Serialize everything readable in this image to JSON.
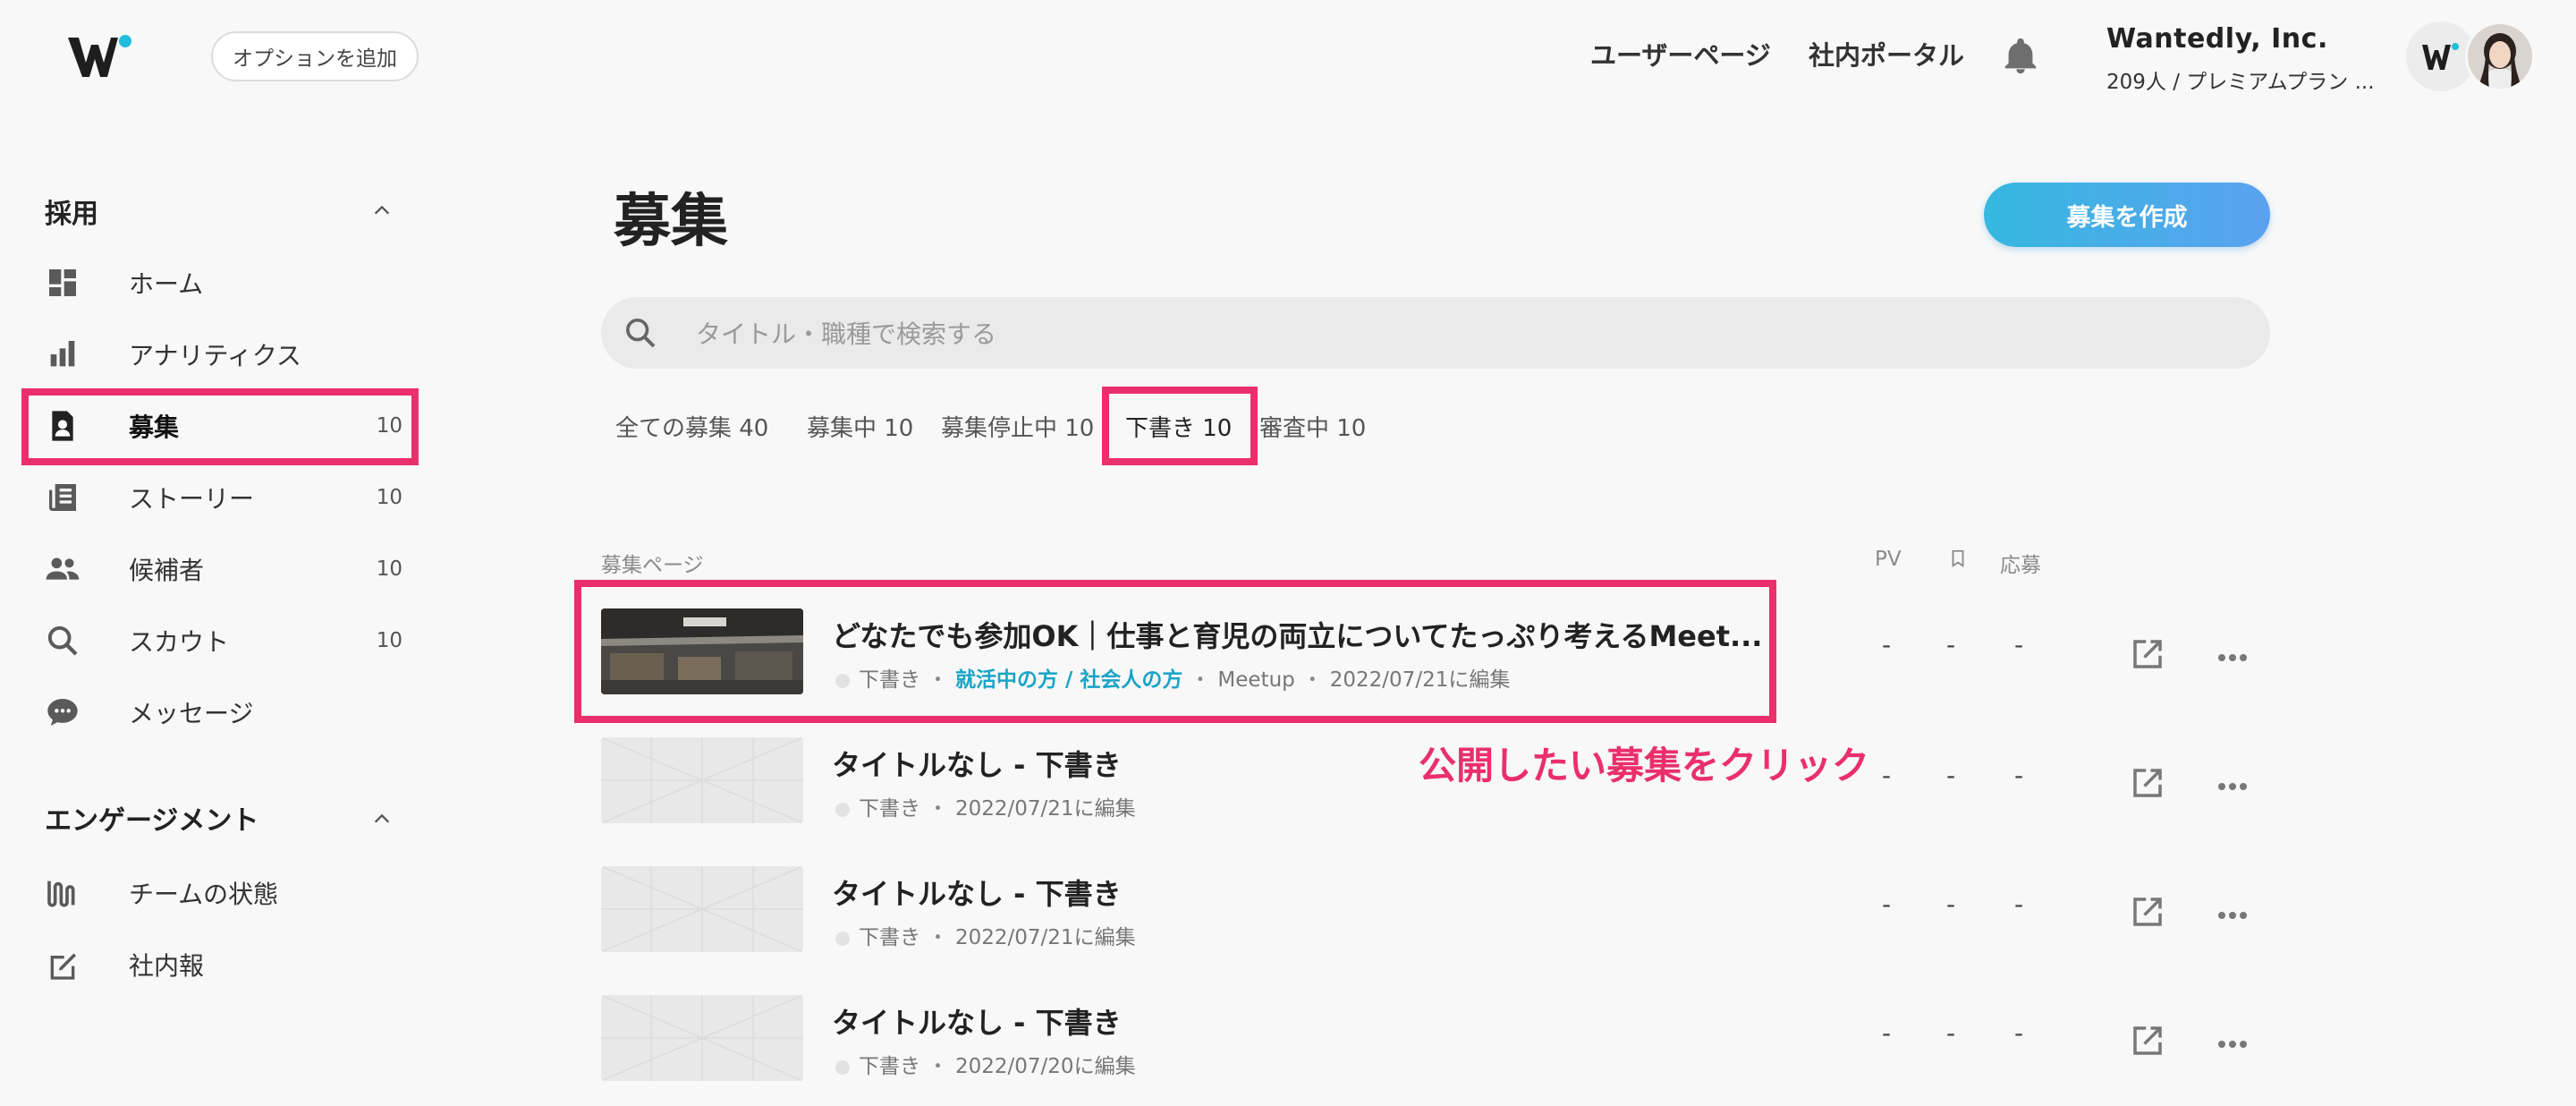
{
  "header": {
    "option_button": "オプションを追加",
    "nav_user_page": "ユーザーページ",
    "nav_portal": "社内ポータル",
    "company_name": "Wantedly, Inc.",
    "company_plan": "209人 / プレミアムプラン ..."
  },
  "sidebar": {
    "section_recruit": "採用",
    "items": [
      {
        "label": "ホーム",
        "count": ""
      },
      {
        "label": "アナリティクス",
        "count": ""
      },
      {
        "label": "募集",
        "count": "10"
      },
      {
        "label": "ストーリー",
        "count": "10"
      },
      {
        "label": "候補者",
        "count": "10"
      },
      {
        "label": "スカウト",
        "count": "10"
      },
      {
        "label": "メッセージ",
        "count": ""
      }
    ],
    "section_engagement": "エンゲージメント",
    "engagement_items": [
      {
        "label": "チームの状態"
      },
      {
        "label": "社内報"
      }
    ]
  },
  "main": {
    "title": "募集",
    "create_button": "募集を作成",
    "search_placeholder": "タイトル・職種で検索する",
    "tabs": [
      {
        "label": "全ての募集 40"
      },
      {
        "label": "募集中 10"
      },
      {
        "label": "募集停止中 10"
      },
      {
        "label": "下書き 10"
      },
      {
        "label": "審査中 10"
      }
    ],
    "columns": {
      "page": "募集ページ",
      "pv": "PV",
      "apply": "応募"
    },
    "rows": [
      {
        "title": "どなたでも参加OK｜仕事と育児の両立についてたっぷり考えるMeet...",
        "status": "下書き",
        "tag": "就活中の方 / 社会人の方",
        "type": "Meetup",
        "edited": "2022/07/21に編集",
        "pv": "-",
        "bookmark": "-",
        "apply": "-"
      },
      {
        "title": "タイトルなし - 下書き",
        "status": "下書き",
        "edited": "2022/07/21に編集",
        "pv": "-",
        "bookmark": "-",
        "apply": "-"
      },
      {
        "title": "タイトルなし - 下書き",
        "status": "下書き",
        "edited": "2022/07/21に編集",
        "pv": "-",
        "bookmark": "-",
        "apply": "-"
      },
      {
        "title": "タイトルなし - 下書き",
        "status": "下書き",
        "edited": "2022/07/20に編集",
        "pv": "-",
        "bookmark": "-",
        "apply": "-"
      }
    ],
    "meta_sep": "・"
  },
  "annotation": "公開したい募集をクリック",
  "colors": {
    "highlight": "#ea2f6c",
    "accent": "#35b8e0",
    "tag": "#1aa3c6"
  },
  "icons": [
    "logo-icon",
    "bell-icon",
    "dashboard-icon",
    "bar-chart-icon",
    "badge-icon",
    "article-icon",
    "people-icon",
    "search-icon",
    "chat-icon",
    "pulse-icon",
    "edit-icon",
    "chevron-up-icon",
    "external-link-icon",
    "more-icon",
    "bookmark-icon"
  ]
}
